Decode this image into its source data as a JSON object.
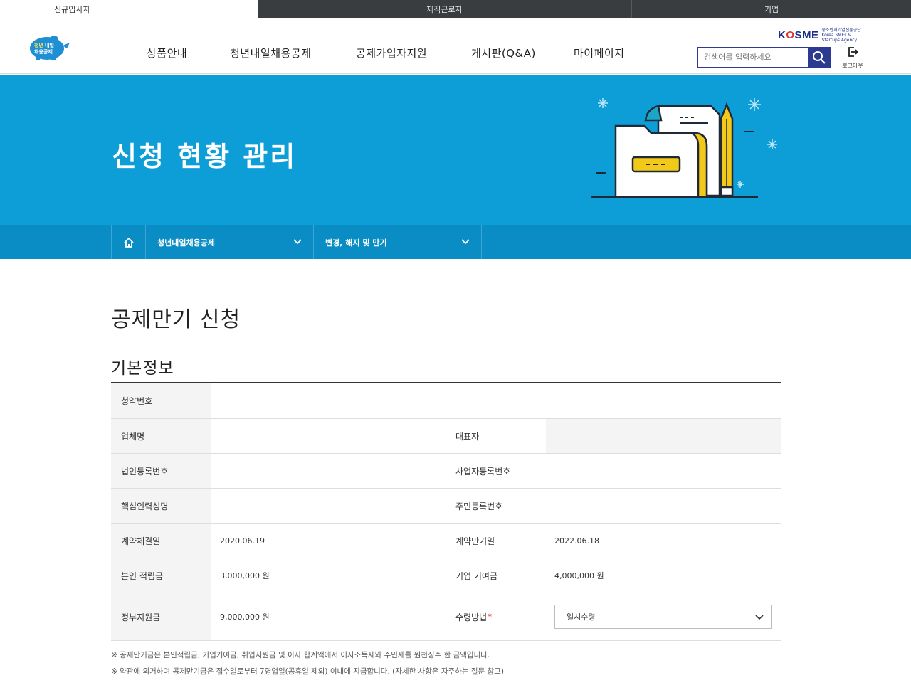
{
  "topbar": {
    "tabs": [
      {
        "label": "신규입사자"
      },
      {
        "label": "재직근로자"
      },
      {
        "label": "기업"
      }
    ]
  },
  "header": {
    "logo_text_line1": "청년내일",
    "logo_text_line2": "채용공제",
    "nav": [
      {
        "label": "상품안내"
      },
      {
        "label": "청년내일채용공제"
      },
      {
        "label": "공제가입자지원"
      },
      {
        "label": "게시판(Q&A)"
      },
      {
        "label": "마이페이지"
      }
    ],
    "kosme": {
      "logo": "KOSME",
      "sub": "중소벤처기업진흥공단 Korea SMEs & Startups Agency"
    },
    "search_placeholder": "검색어를 입력하세요",
    "logout_label": "로그아웃"
  },
  "banner": {
    "title": "신청 현황 관리"
  },
  "locnav": {
    "dropdown1": "청년내일채용공제",
    "dropdown2": "변경, 해지 및 만기"
  },
  "page_title": "공제만기 신청",
  "section_title": "기본정보",
  "table": {
    "contract_no_label": "청약번호",
    "contract_no_value": "",
    "company_label": "업체명",
    "company_value": "",
    "ceo_label": "대표자",
    "ceo_value": "",
    "corp_reg_label": "법인등록번호",
    "corp_reg_value": "",
    "biz_reg_label": "사업자등록번호",
    "biz_reg_value": "",
    "core_name_label": "핵심인력성명",
    "core_name_value": "",
    "resident_no_label": "주민등록번호",
    "resident_no_value": "",
    "contract_date_label": "계약체결일",
    "contract_date_value": "2020.06.19",
    "maturity_date_label": "계약만기일",
    "maturity_date_value": "2022.06.18",
    "self_saving_label": "본인 적립금",
    "self_saving_value": "3,000,000 원",
    "company_contrib_label": "기업 기여금",
    "company_contrib_value": "4,000,000 원",
    "gov_support_label": "정부지원금",
    "gov_support_value": "9,000,000 원",
    "receive_method_label": "수령방법",
    "receive_method_required": "*",
    "receive_method_value": "일시수령"
  },
  "notes": [
    "※ 공제만기금은 본인적립금, 기업기여금, 취업지원금 및 이자 합계액에서 이자소득세와 주민세를 원천징수 한 금액입니다.",
    "※ 약관에 의거하여 공제만기금은 접수일로부터 7영업일(공휴일 제외) 이내에 지급합니다. (자세한 사항은 자주하는 질문 참고)"
  ],
  "colors": {
    "banner_bg": "#0d9ed8",
    "locnav_bg": "#0a8cc4",
    "topbar_dark": "#3a3d40",
    "search_button": "#2c3a8f"
  }
}
